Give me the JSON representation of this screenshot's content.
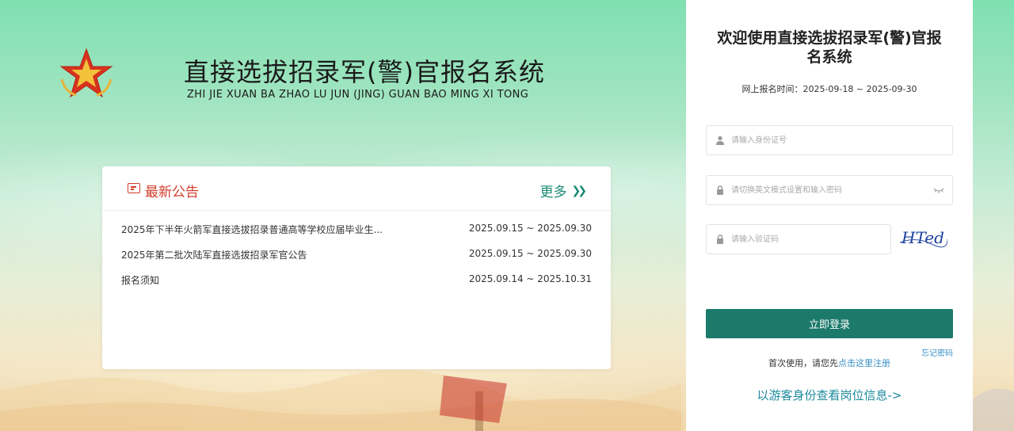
{
  "header": {
    "title": "直接选拔招录军(警)官报名系统",
    "subtitle": "ZHI JIE XUAN BA ZHAO LU JUN (JING) GUAN BAO MING XI TONG"
  },
  "notices": {
    "heading": "最新公告",
    "more_label": "更多",
    "items": [
      {
        "title": "2025年下半年火箭军直接选拔招录普通高等学校应届毕业生...",
        "date": "2025.09.15 ~ 2025.09.30"
      },
      {
        "title": "2025年第二批次陆军直接选拔招录军官公告",
        "date": "2025.09.15 ~ 2025.09.30"
      },
      {
        "title": "报名须知",
        "date": "2025.09.14 ~ 2025.10.31"
      }
    ]
  },
  "login": {
    "title": "欢迎使用直接选拔招录军(警)官报名系统",
    "time": "网上报名时间：2025-09-18 ~ 2025-09-30",
    "id_placeholder": "请输入身份证号",
    "password_placeholder": "请切换英文模式设置和输入密码",
    "captcha_placeholder": "请输入验证码",
    "captcha_text": "HTed",
    "submit_label": "立即登录",
    "forgot_label": "忘记密码",
    "first_use_prefix": "首次使用，请您先",
    "register_label": "点击这里注册",
    "guest_label": "以游客身份查看岗位信息->"
  },
  "colors": {
    "accent": "#1c7a6b",
    "notice_red": "#d23c2a",
    "link_blue": "#3a8fc4"
  },
  "icons": {
    "emblem": "star-emblem-icon",
    "notice": "notice-icon",
    "more": "double-chevron-right-icon",
    "user": "user-icon",
    "lock": "lock-icon",
    "eye": "eye-closed-icon"
  }
}
